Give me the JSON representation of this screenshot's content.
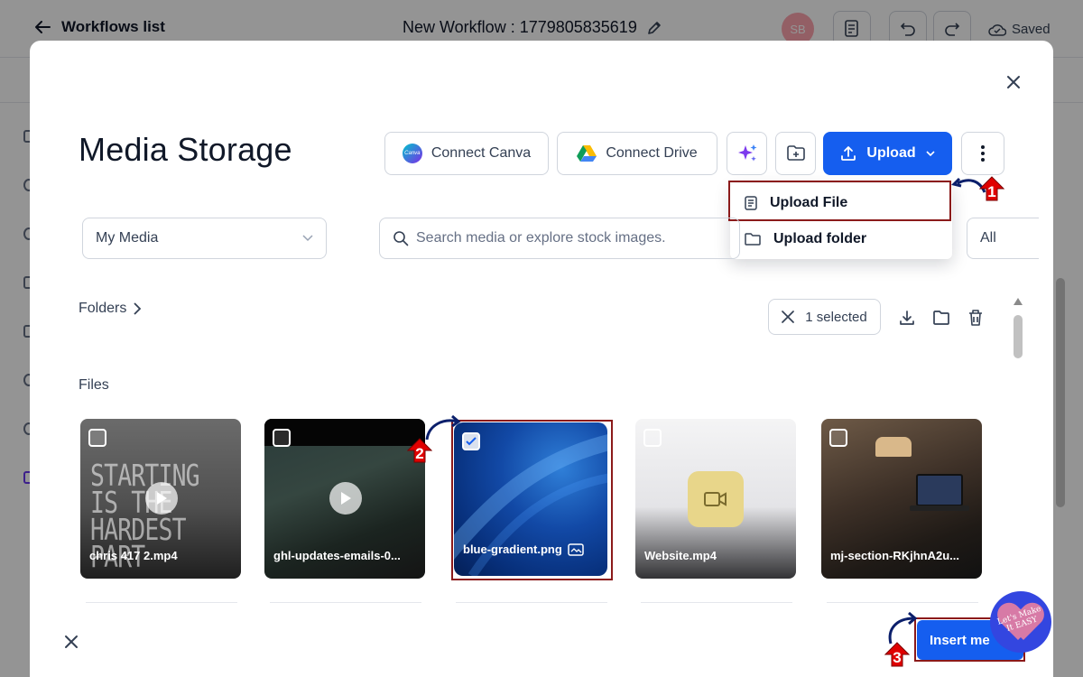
{
  "background": {
    "back_label": "Workflows list",
    "workflow_title": "New Workflow : 1779805835619",
    "avatar_initials": "SB",
    "saved_label": "Saved"
  },
  "modal": {
    "title": "Media Storage",
    "buttons": {
      "connect_canva": "Connect Canva",
      "canva_logo_text": "Canva",
      "connect_drive": "Connect Drive",
      "upload": "Upload"
    },
    "upload_menu": {
      "items": [
        {
          "label": "Upload File",
          "icon": "file-icon"
        },
        {
          "label": "Upload folder",
          "icon": "folder-icon"
        }
      ]
    },
    "source_select": {
      "value": "My Media"
    },
    "search": {
      "placeholder": "Search media or explore stock images."
    },
    "type_filter": {
      "value": "All"
    },
    "folders_label": "Folders",
    "selection": {
      "label": "1 selected"
    },
    "files_label": "Files",
    "files": [
      {
        "name": "chris 417 2.mp4",
        "kind": "video",
        "selected": false,
        "thumb_text": "STARTING IS THE HARDEST PART"
      },
      {
        "name": "ghl-updates-emails-0...",
        "kind": "video",
        "selected": false
      },
      {
        "name": "blue-gradient.png",
        "kind": "image",
        "selected": true
      },
      {
        "name": "Website.mp4",
        "kind": "video",
        "selected": false
      },
      {
        "name": "mj-section-RKjhnA2u...",
        "kind": "image",
        "selected": false
      }
    ],
    "insert_button": "Insert me"
  },
  "annotations": {
    "steps": [
      "1",
      "2",
      "3"
    ],
    "highlight_color": "#8b1a1a",
    "badge_color": "#e00000"
  },
  "watermark": {
    "text": "Let's Make It EASY"
  },
  "colors": {
    "primary": "#155eef",
    "text": "#101828",
    "muted": "#344054",
    "border": "#d0d5dd"
  }
}
